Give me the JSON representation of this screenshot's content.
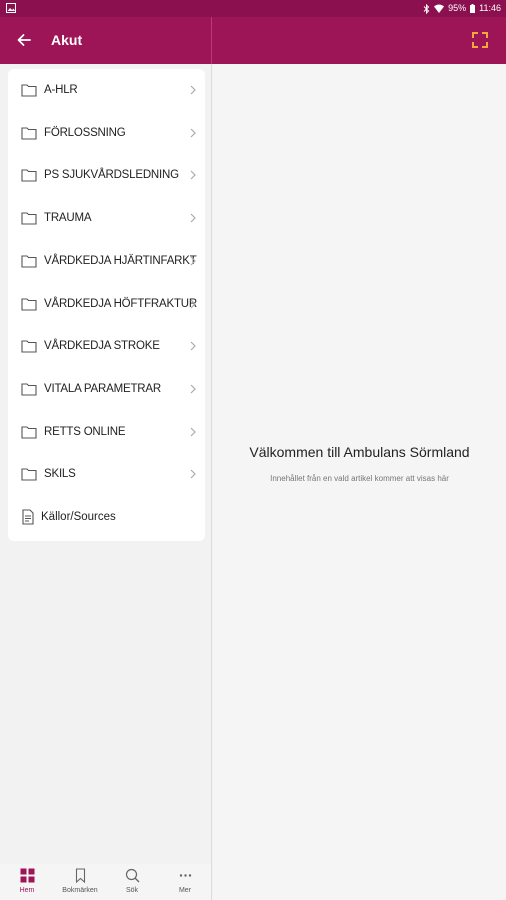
{
  "status_bar": {
    "battery": "95%",
    "time": "11:46"
  },
  "app_bar": {
    "title": "Akut"
  },
  "list": {
    "items": [
      {
        "label": "A-HLR",
        "icon": "folder-icon"
      },
      {
        "label": "FÖRLOSSNING",
        "icon": "folder-icon"
      },
      {
        "label": "PS SJUKVÅRDSLEDNING",
        "icon": "folder-icon"
      },
      {
        "label": "TRAUMA",
        "icon": "folder-icon"
      },
      {
        "label": "VÅRDKEDJA HJÄRTINFARKT",
        "icon": "folder-icon"
      },
      {
        "label": "VÅRDKEDJA HÖFTFRAKTUR",
        "icon": "folder-icon"
      },
      {
        "label": "VÅRDKEDJA STROKE",
        "icon": "folder-icon"
      },
      {
        "label": "VITALA PARAMETRAR",
        "icon": "folder-icon"
      },
      {
        "label": "RETTS ONLINE",
        "icon": "folder-icon"
      },
      {
        "label": "SKILS",
        "icon": "folder-icon"
      },
      {
        "label": "Källor/Sources",
        "icon": "document-icon"
      }
    ]
  },
  "content": {
    "welcome": "Välkommen till Ambulans Sörmland",
    "subtext": "Innehållet från en vald artikel kommer att visas här"
  },
  "bottom_nav": {
    "items": [
      {
        "label": "Hem",
        "icon": "grid-icon",
        "active": true
      },
      {
        "label": "Bokmärken",
        "icon": "bookmark-icon",
        "active": false
      },
      {
        "label": "Sök",
        "icon": "search-icon",
        "active": false
      },
      {
        "label": "Mer",
        "icon": "more-icon",
        "active": false
      }
    ]
  },
  "colors": {
    "primary": "#9d1457",
    "status": "#8a1050",
    "accent": "#f2a93b"
  }
}
